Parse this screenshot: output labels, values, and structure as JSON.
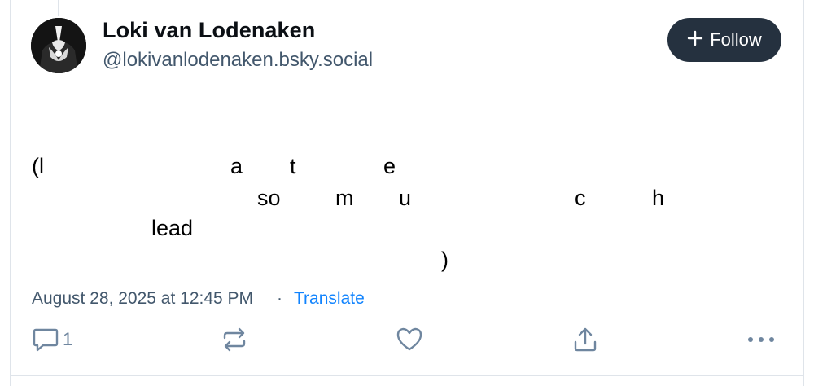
{
  "author": {
    "display_name": "Loki van Lodenaken",
    "handle": "@lokivanlodenaken.bsky.social"
  },
  "follow_button": {
    "label": "Follow",
    "icon": "plus-icon"
  },
  "post": {
    "text_fragments": {
      "line1_open": "(l",
      "line1_a": "a",
      "line1_t": "t",
      "line1_e": "e",
      "line2_so": "so",
      "line2_m": "m",
      "line2_u": "u",
      "line2_c": "c",
      "line2_h": "h",
      "line3_lead": "lead",
      "line4_close": ")"
    },
    "date": "August 28, 2025 at 12:45 PM",
    "separator": "·",
    "translate_label": "Translate"
  },
  "actions": {
    "reply": {
      "icon": "reply-icon",
      "count": "1"
    },
    "repost": {
      "icon": "repost-icon"
    },
    "like": {
      "icon": "heart-icon"
    },
    "share": {
      "icon": "share-icon"
    },
    "more": {
      "icon": "more-options-icon"
    }
  },
  "colors": {
    "follow_bg": "#25313f",
    "link": "#1083fe",
    "muted": "#42576c",
    "icon": "#6f869f"
  }
}
